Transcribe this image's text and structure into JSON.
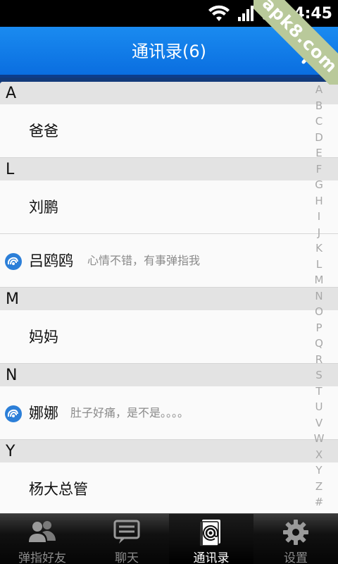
{
  "status_bar": {
    "time": "4:45"
  },
  "watermark": "apk8.com",
  "header": {
    "title": "通讯录(6)"
  },
  "contacts": {
    "sections": [
      {
        "letter": "A",
        "items": [
          {
            "name": "爸爸"
          }
        ]
      },
      {
        "letter": "L",
        "items": [
          {
            "name": "刘鹏"
          },
          {
            "name": "吕鸥鸥",
            "status": "心情不错，有事弹指我"
          }
        ]
      },
      {
        "letter": "M",
        "items": [
          {
            "name": "妈妈"
          }
        ]
      },
      {
        "letter": "N",
        "items": [
          {
            "name": "娜娜",
            "status": "肚子好痛，是不是。。。。"
          }
        ]
      },
      {
        "letter": "Y",
        "items": [
          {
            "name": "杨大总管"
          }
        ]
      }
    ]
  },
  "index_letters": [
    "A",
    "B",
    "C",
    "D",
    "E",
    "F",
    "G",
    "H",
    "I",
    "J",
    "K",
    "L",
    "M",
    "N",
    "O",
    "P",
    "Q",
    "R",
    "S",
    "T",
    "U",
    "V",
    "W",
    "X",
    "Y",
    "Z",
    "#"
  ],
  "tabs": [
    {
      "label": "弹指好友",
      "icon": "friends-icon"
    },
    {
      "label": "聊天",
      "icon": "chat-icon"
    },
    {
      "label": "通讯录",
      "icon": "contacts-icon",
      "active": true
    },
    {
      "label": "设置",
      "icon": "settings-gear-icon"
    }
  ],
  "colors": {
    "accent": "#0a7ae8",
    "section_bg": "#e3e3e3",
    "tab_active_text": "#ffffff"
  }
}
